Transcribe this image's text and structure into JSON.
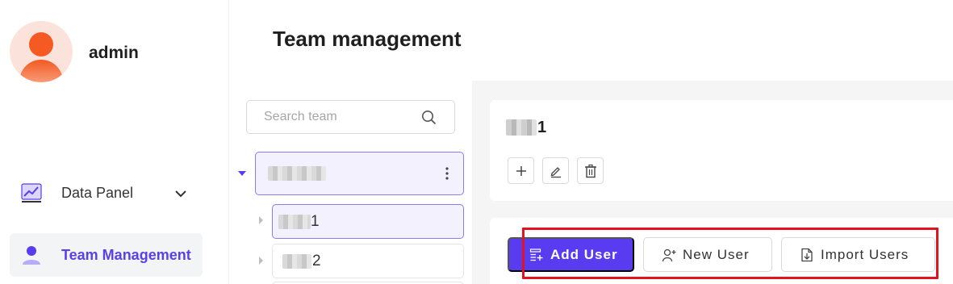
{
  "user": {
    "name": "admin"
  },
  "sidebar": {
    "items": [
      {
        "label": "Data Panel",
        "icon": "chart-icon",
        "expandable": true
      },
      {
        "label": "Team Management",
        "icon": "user-icon",
        "active": true
      }
    ]
  },
  "page": {
    "title": "Team management"
  },
  "team_tree": {
    "search_placeholder": "Search team",
    "nodes": [
      {
        "label_suffix": "",
        "level": 0,
        "expanded": true
      },
      {
        "label_suffix": "1",
        "level": 1,
        "selected": true
      },
      {
        "label_suffix": "2",
        "level": 1
      }
    ]
  },
  "team_detail": {
    "name_suffix": "1",
    "actions": [
      "add-icon",
      "edit-icon",
      "delete-icon"
    ]
  },
  "user_actions": {
    "add_user": "Add User",
    "new_user": "New User",
    "import_users": "Import Users"
  },
  "colors": {
    "accent": "#5a3cf0",
    "highlight": "#e0141e",
    "avatar": "#f45a22"
  }
}
